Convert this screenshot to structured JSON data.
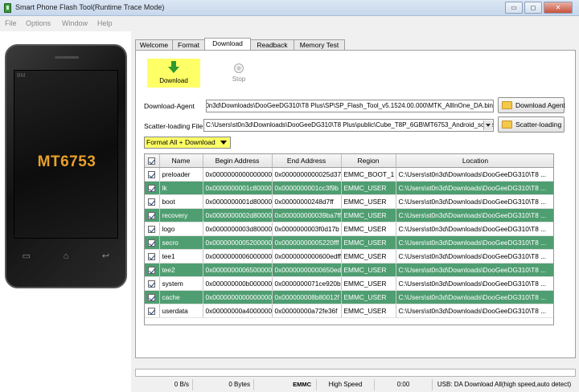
{
  "window": {
    "title": "Smart Phone Flash Tool(Runtime Trace Mode)",
    "minimize_glyph": "▭",
    "maximize_glyph": "◻",
    "close_glyph": "✕"
  },
  "menu": [
    "File",
    "Options",
    "Window",
    "Help"
  ],
  "phone": {
    "corner_text": "BM",
    "chip": "MT6753"
  },
  "tabs": [
    {
      "label": "Welcome",
      "active": false
    },
    {
      "label": "Format",
      "active": false
    },
    {
      "label": "Download",
      "active": true
    },
    {
      "label": "Readback",
      "active": false
    },
    {
      "label": "Memory Test",
      "active": false
    }
  ],
  "toolbar": {
    "download_label": "Download",
    "stop_label": "Stop"
  },
  "download_agent": {
    "label": "Download-Agent",
    "value": "0n3d\\Downloads\\DooGeeDG310\\T8 Plus\\SP\\SP_Flash_Tool_v5.1524.00.000\\MTK_AllInOne_DA.bin",
    "button": "Download Agent"
  },
  "scatter": {
    "label": "Scatter-loading File",
    "value": "C:\\Users\\st0n3d\\Downloads\\DooGeeDG310\\T8 Plus\\public\\Cube_T8P_6GB\\MT6753_Android_scatter.txt",
    "button": "Scatter-loading"
  },
  "mode": {
    "selected": "Format All + Download"
  },
  "columns": [
    "",
    "Name",
    "Begin Address",
    "End Address",
    "Region",
    "Location"
  ],
  "rows": [
    {
      "name": "preloader",
      "begin": "0x0000000000000000",
      "end": "0x0000000000025d37",
      "region": "EMMC_BOOT_1",
      "location": "C:\\Users\\st0n3d\\Downloads\\DooGeeDG310\\T8 ...",
      "highlight": false
    },
    {
      "name": "lk",
      "begin": "0x0000000001c80000",
      "end": "0x0000000001cc3f9b",
      "region": "EMMC_USER",
      "location": "C:\\Users\\st0n3d\\Downloads\\DooGeeDG310\\T8 ...",
      "highlight": true
    },
    {
      "name": "boot",
      "begin": "0x0000000001d80000",
      "end": "0x00000000248d7ff",
      "region": "EMMC_USER",
      "location": "C:\\Users\\st0n3d\\Downloads\\DooGeeDG310\\T8 ...",
      "highlight": false
    },
    {
      "name": "recovery",
      "begin": "0x0000000002d80000",
      "end": "0x000000000039ba7ff",
      "region": "EMMC_USER",
      "location": "C:\\Users\\st0n3d\\Downloads\\DooGeeDG310\\T8 ...",
      "highlight": true
    },
    {
      "name": "logo",
      "begin": "0x0000000003d80000",
      "end": "0x0000000003f0d17b",
      "region": "EMMC_USER",
      "location": "C:\\Users\\st0n3d\\Downloads\\DooGeeDG310\\T8 ...",
      "highlight": false
    },
    {
      "name": "secro",
      "begin": "0x0000000005200000",
      "end": "0x00000000005220fff",
      "region": "EMMC_USER",
      "location": "C:\\Users\\st0n3d\\Downloads\\DooGeeDG310\\T8 ...",
      "highlight": true
    },
    {
      "name": "tee1",
      "begin": "0x0000000006000000",
      "end": "0x0000000000600edff",
      "region": "EMMC_USER",
      "location": "C:\\Users\\st0n3d\\Downloads\\DooGeeDG310\\T8 ...",
      "highlight": false
    },
    {
      "name": "tee2",
      "begin": "0x0000000006500000",
      "end": "0x00000000000650edff",
      "region": "EMMC_USER",
      "location": "C:\\Users\\st0n3d\\Downloads\\DooGeeDG310\\T8 ...",
      "highlight": true
    },
    {
      "name": "system",
      "begin": "0x000000000b000000",
      "end": "0x0000000071ce920b",
      "region": "EMMC_USER",
      "location": "C:\\Users\\st0n3d\\Downloads\\DooGeeDG310\\T8 ...",
      "highlight": false
    },
    {
      "name": "cache",
      "begin": "0x00000000000000000",
      "end": "0x000000008b80012f",
      "region": "EMMC_USER",
      "location": "C:\\Users\\st0n3d\\Downloads\\DooGeeDG310\\T8 ...",
      "highlight": true
    },
    {
      "name": "userdata",
      "begin": "0x00000000a4000000",
      "end": "0x00000000a72fe36f",
      "region": "EMMC_USER",
      "location": "C:\\Users\\st0n3d\\Downloads\\DooGeeDG310\\T8 ...",
      "highlight": false
    }
  ],
  "status": {
    "speed": "0 B/s",
    "bytes": "0 Bytes",
    "storage": "EMMC",
    "mode": "High Speed",
    "time": "0:00",
    "usb": "USB: DA Download All(high speed,auto detect)"
  },
  "colors": {
    "highlight_row": "#4f9e71",
    "yellow_mark": "#ffff66",
    "chip_text": "#e8a02b"
  }
}
